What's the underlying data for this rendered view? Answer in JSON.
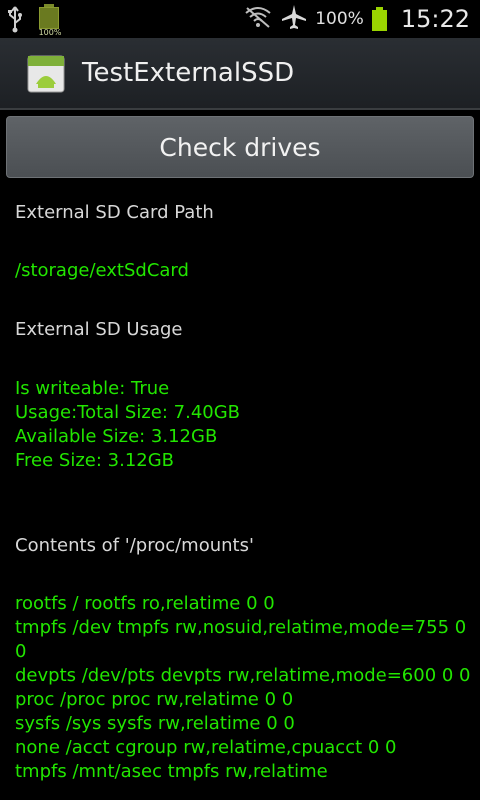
{
  "status_bar": {
    "left_icons": [
      "usb-icon",
      "battery-small-icon"
    ],
    "battery_small_label": "100%",
    "right_icons": [
      "wifi-off-icon",
      "airplane-icon",
      "battery-full-icon"
    ],
    "battery_percent": "100%",
    "time": "15:22",
    "colors": {
      "battery": "#9ad400"
    }
  },
  "title_bar": {
    "app_icon": "android-app-icon",
    "title": "TestExternalSSD"
  },
  "button": {
    "label": "Check drives"
  },
  "content": {
    "sd_path_label": "External SD Card Path",
    "sd_path_value": "/storage/extSdCard",
    "usage_label": "External SD Usage",
    "usage_lines": [
      "Is writeable: True",
      "Usage:Total Size: 7.40GB",
      "Available Size: 3.12GB",
      "Free Size: 3.12GB"
    ],
    "mounts_label": "Contents of '/proc/mounts'",
    "mounts_lines": [
      "rootfs / rootfs ro,relatime 0 0",
      "tmpfs /dev tmpfs rw,nosuid,relatime,mode=755 0 0",
      "devpts /dev/pts devpts rw,relatime,mode=600 0 0",
      "proc /proc proc rw,relatime 0 0",
      "sysfs /sys sysfs rw,relatime 0 0",
      "none /acct cgroup rw,relatime,cpuacct 0 0",
      "tmpfs /mnt/asec tmpfs rw,relatime"
    ],
    "colors": {
      "value_text": "#22e600",
      "label_text": "#d8d8d8"
    }
  }
}
